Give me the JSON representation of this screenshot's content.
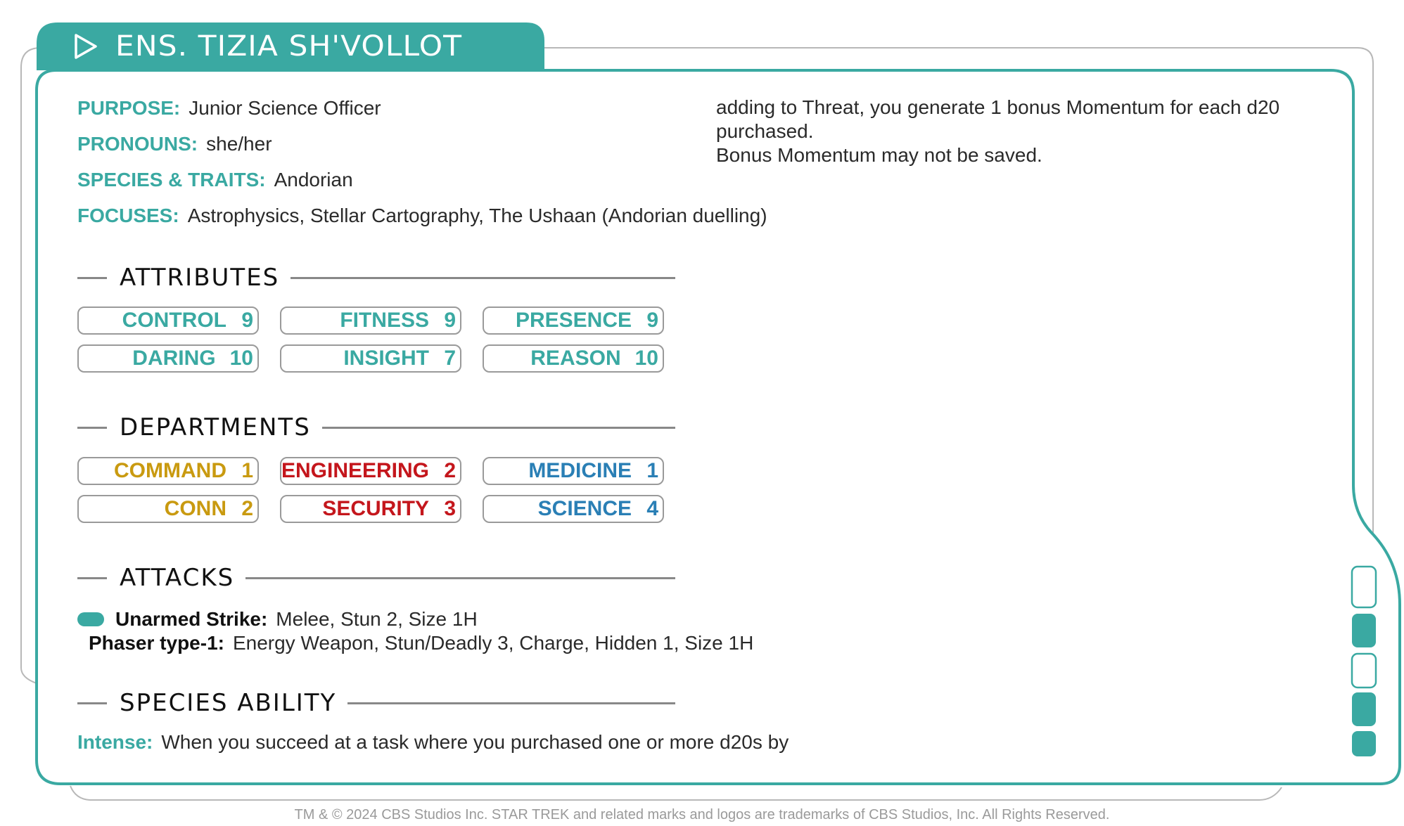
{
  "title": "ENS. TIZIA SH'VOLLOT",
  "fields": [
    {
      "label": "PURPOSE:",
      "value": "Junior Science Officer"
    },
    {
      "label": "PRONOUNS:",
      "value": "she/her"
    },
    {
      "label": "SPECIES & TRAITS:",
      "value": "Andorian"
    },
    {
      "label": "FOCUSES:",
      "value": "Astrophysics, Stellar Cartography, The Ushaan (Andorian duelling)"
    }
  ],
  "sections": {
    "attributes": "ATTRIBUTES",
    "departments": "DEPARTMENTS",
    "attacks": "ATTACKS",
    "species_ability": "SPECIES ABILITY"
  },
  "attributes": [
    {
      "label": "CONTROL",
      "value": "9"
    },
    {
      "label": "FITNESS",
      "value": "9"
    },
    {
      "label": "PRESENCE",
      "value": "9"
    },
    {
      "label": "DARING",
      "value": "10"
    },
    {
      "label": "INSIGHT",
      "value": "7"
    },
    {
      "label": "REASON",
      "value": "10"
    }
  ],
  "departments": [
    {
      "label": "COMMAND",
      "value": "1",
      "color": "#c99a10"
    },
    {
      "label": "ENGINEERING",
      "value": "2",
      "color": "#c4161c"
    },
    {
      "label": "MEDICINE",
      "value": "1",
      "color": "#2a7fb5"
    },
    {
      "label": "CONN",
      "value": "2",
      "color": "#c99a10"
    },
    {
      "label": "SECURITY",
      "value": "3",
      "color": "#c4161c"
    },
    {
      "label": "SCIENCE",
      "value": "4",
      "color": "#2a7fb5"
    }
  ],
  "attacks": [
    {
      "name": "Unarmed Strike:",
      "detail": "Melee, Stun 2, Size 1H"
    },
    {
      "name": "Phaser type-1:",
      "detail": "Energy Weapon, Stun/Deadly 3, Charge, Hidden 1, Size 1H"
    }
  ],
  "ability": {
    "label": "Intense:",
    "text": "When you succeed at a task where you purchased one or more d20s by"
  },
  "ability_continued": [
    "adding to Threat, you generate 1 bonus Momentum for each d20 purchased.",
    "Bonus Momentum may not be saved."
  ],
  "footer": "TM & © 2024 CBS Studios Inc. STAR TREK and related marks and logos are trademarks of CBS Studios, Inc. All Rights Reserved.",
  "colors": {
    "accent": "#3aa9a2",
    "attribute": "#3aa9a2",
    "frame_gray": "#9a9a9a"
  },
  "icons": {
    "title": "play-triangle-icon"
  }
}
